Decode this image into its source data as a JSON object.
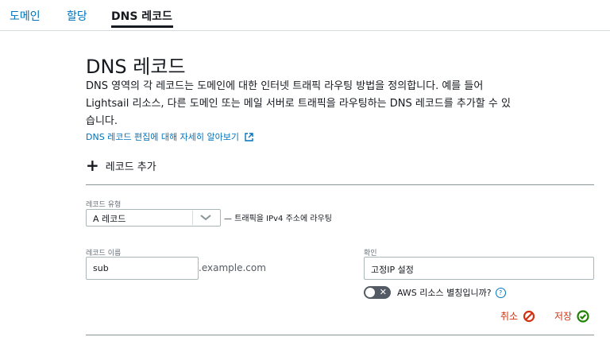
{
  "tabs": [
    {
      "label": "도메인"
    },
    {
      "label": "할당"
    },
    {
      "label": "DNS 레코드"
    }
  ],
  "page": {
    "title": "DNS 레코드",
    "description": "DNS 영역의 각 레코드는 도메인에 대한 인터넷 트래픽 라우팅 방법을 정의합니다. 예를 들어 Lightsail 리소스, 다른 도메인 또는 메일 서버로 트래픽을 라우팅하는 DNS 레코드를 추가할 수 있습니다.",
    "learn_more": "DNS 레코드 편집에 대해 자세히 알아보기"
  },
  "add_record": {
    "label": "레코드 추가"
  },
  "form": {
    "type_label": "레코드 유형",
    "type_value": "A 레코드",
    "type_hint": "— 트래픽을 IPv4 주소에 라우팅",
    "name_label": "레코드 이름",
    "name_value": "sub",
    "name_suffix": ".example.com",
    "resolve_label": "확인",
    "resolve_value": "고정IP 설정",
    "alias_toggle_label": "AWS 리소스 별칭입니까?",
    "alias_toggle_on": false,
    "help_glyph": "?"
  },
  "actions": {
    "cancel": "취소",
    "save": "저장"
  },
  "colors": {
    "link": "#0073bb",
    "cancel": "#d13212",
    "save_icon": "#1d8102"
  }
}
